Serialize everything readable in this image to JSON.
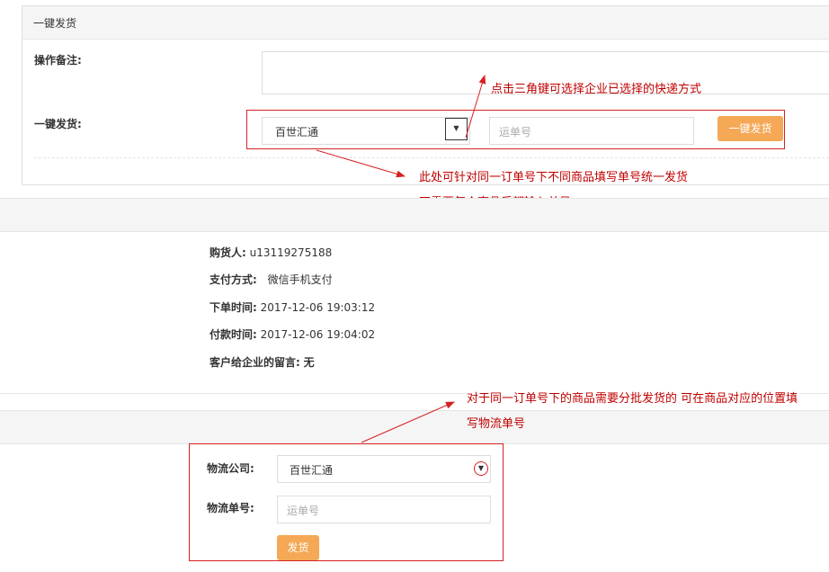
{
  "panel": {
    "title": "一键发货",
    "remark_label": "操作备注:",
    "ship_label": "一键发货:",
    "select_value": "百世汇通",
    "tracking_placeholder": "运单号",
    "ship_button": "一键发货"
  },
  "notes": {
    "n1": "点击三角键可选择企业已选择的快递方式",
    "n2_line1": "此处可针对同一订单号下不同商品填写单号统一发货",
    "n2_line2": "不需要每个商品后都输入单号",
    "n3_line1": "对于同一订单号下的商品需要分批发货的 可在商品对应的位置填",
    "n3_line2": "写物流单号"
  },
  "order": {
    "buyer_label": "购货人:",
    "buyer_value": "u13119275188",
    "pay_label": "支付方式:",
    "pay_value": "微信手机支付",
    "order_time_label": "下单时间:",
    "order_time_value": "2017-12-06 19:03:12",
    "paid_time_label": "付款时间:",
    "paid_time_value": "2017-12-06 19:04:02",
    "message_label": "客户给企业的留言:",
    "message_value": "无"
  },
  "shipping": {
    "company_label": "物流公司:",
    "company_value": "百世汇通",
    "tracking_label": "物流单号:",
    "tracking_placeholder": "运单号",
    "ship_button": "发货"
  },
  "colors": {
    "accent": "#f5a855",
    "annotation": "#d62222"
  },
  "icons": {
    "dropdown": "triangle-down-icon"
  }
}
